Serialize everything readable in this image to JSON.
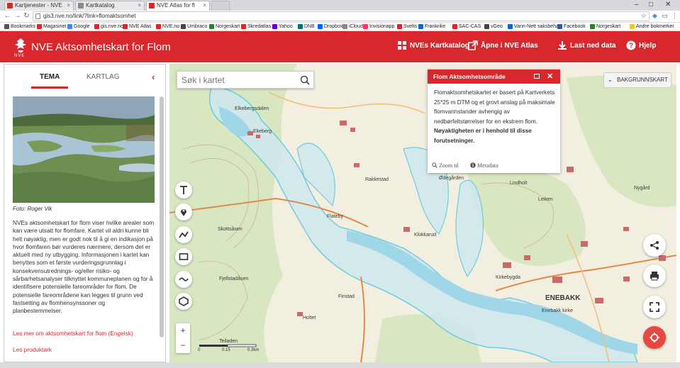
{
  "browser": {
    "tabs": [
      {
        "label": "Kartjenester - NVE"
      },
      {
        "label": "Kartkatalog"
      },
      {
        "label": "NVE Atlas for fl"
      }
    ],
    "url": "gis3.nve.no/link/?link=flomaktsomhet",
    "bookmarks": [
      {
        "label": "Bookmarks",
        "color": "#555555"
      },
      {
        "label": "Magasinet",
        "color": "#d8272d"
      },
      {
        "label": "Google",
        "color": "#4285f4"
      },
      {
        "label": "gis.nve.no",
        "color": "#d8272d"
      },
      {
        "label": "NVE Atlas",
        "color": "#d8272d"
      },
      {
        "label": "NVE.no",
        "color": "#d8272d"
      },
      {
        "label": "Umbraco",
        "color": "#444444"
      },
      {
        "label": "Norgeskart",
        "color": "#2e7d32"
      },
      {
        "label": "Skredatlas",
        "color": "#d8272d"
      },
      {
        "label": "Yahoo",
        "color": "#6001d2"
      },
      {
        "label": "DNB",
        "color": "#007272"
      },
      {
        "label": "Dropbox",
        "color": "#0061ff"
      },
      {
        "label": "iCloud",
        "color": "#888888"
      },
      {
        "label": "Invisionapp",
        "color": "#ff3366"
      },
      {
        "label": "Svelts",
        "color": "#d8272d"
      },
      {
        "label": "Frankrike",
        "color": "#1565c0"
      },
      {
        "label": "SAC-CAS",
        "color": "#d8272d"
      },
      {
        "label": "vGeo",
        "color": "#444444"
      },
      {
        "label": "Vann-Nett saksbehan",
        "color": "#1565c0"
      },
      {
        "label": "Facebook",
        "color": "#3b5998"
      },
      {
        "label": "Norgeskart",
        "color": "#2e7d32"
      },
      {
        "label": "Andre bokmerker",
        "color": "#f0c040"
      }
    ]
  },
  "header": {
    "logo_text": "NVE",
    "title": "NVE Aktsomhetskart for Flom",
    "links": {
      "kartkatalog": "NVEs Kartkatalog",
      "atlas": "Åpne i NVE Atlas",
      "download": "Last ned data",
      "help": "Hjelp"
    }
  },
  "panel": {
    "tabs": {
      "tema": "TEMA",
      "kartlag": "KARTLAG"
    },
    "caption": "Foto: Roger Vik",
    "body": "NVEs aktsomhetskart for flom viser hvilke arealer som kan være utsatt for flomfare. Kartet vil aldri kunne bli helt nøyaktig, men er godt nok til å gi en indikasjon på hvor flomfaren bør vurderes nærmere, dersom det er aktuelt med ny utbygging. Informasjonen i kartet kan benyttes som et første vurderingsgrunnlag i konsekvensutrednings- og/eller risiko- og sårbarhetsanalyser tilknyttet kommuneplanen og for å identifisere potensielle fareområder for flom. De potensielle fareområdene kan legges til grunn ved fastsetting av flomhensynssoner og planbestemmelser.",
    "link_more": "Les mer om aktsomhetskart for flom (Engelsk)",
    "link_product": "Les produktark"
  },
  "map": {
    "search_placeholder": "Søk i kartet",
    "background_button": "BAKGRUNNSKART",
    "popup": {
      "title": "Flom Aktsomhetsområde",
      "text": "Flomaktsomhetskartet er basert på Kartverkets 25*25 m DTM og et grovt anslag på maksimale flomvannstander avhengig av nedbørfeltstørrelser for en ekstrem flom.",
      "bold": "Nøyaktigheten er i henhold til disse forutsetninger.",
      "zoom": "Zoom til",
      "metadata": "Metadata"
    },
    "place_names": [
      {
        "label": "Elkebergsdalen",
        "bold": false
      },
      {
        "label": "Ekeberg",
        "bold": false
      },
      {
        "label": "Rakkestad",
        "bold": false
      },
      {
        "label": "Klokkarud",
        "bold": false
      },
      {
        "label": "Fjellstadåsen",
        "bold": false
      },
      {
        "label": "Skottsåsen",
        "bold": false
      },
      {
        "label": "Flateby",
        "bold": false
      },
      {
        "label": "Enebakk kirke",
        "bold": false
      },
      {
        "label": "ENEBAKK",
        "bold": true
      },
      {
        "label": "Kirkebygda",
        "bold": false
      },
      {
        "label": "Holtet",
        "bold": false
      },
      {
        "label": "Finstad",
        "bold": false
      },
      {
        "label": "Leiken",
        "bold": false
      },
      {
        "label": "Nygård",
        "bold": false
      },
      {
        "label": "Teiladen",
        "bold": false
      },
      {
        "label": "Ødegården",
        "bold": false
      },
      {
        "label": "Lindholt",
        "bold": false
      }
    ],
    "scale": {
      "zero": "0",
      "mid": "0.15",
      "end": "0.3km"
    },
    "zoom_in": "+",
    "zoom_out": "−",
    "colors": {
      "flood_zone": "#5ac8e0",
      "water": "#9fd6e8",
      "forest": "#d9e8c0",
      "road": "#e08a4a",
      "accent": "#d8272d"
    }
  }
}
